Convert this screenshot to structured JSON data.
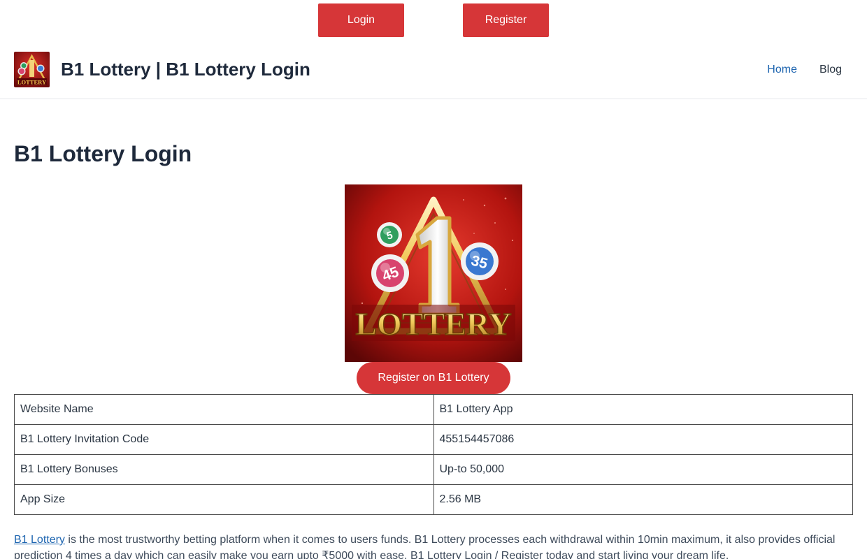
{
  "top_buttons": {
    "login": "Login",
    "register": "Register"
  },
  "header": {
    "logo_text": "LOTTERY",
    "site_title": "B1 Lottery | B1 Lottery Login",
    "nav": {
      "home": "Home",
      "blog": "Blog"
    },
    "nav_active_color": "#1e65b0"
  },
  "page": {
    "title": "B1 Lottery Login"
  },
  "hero": {
    "balls": [
      "5",
      "45",
      "35"
    ],
    "big_number": "1",
    "word": "LOTTERY"
  },
  "cta": {
    "label": "Register on B1 Lottery"
  },
  "colors": {
    "button_red": "#d63638",
    "link_blue": "#1e65b0"
  },
  "table": {
    "rows": [
      {
        "label": "Website Name",
        "value": "B1 Lottery App"
      },
      {
        "label": "B1 Lottery Invitation Code",
        "value": "455154457086"
      },
      {
        "label": "B1 Lottery Bonuses",
        "value": "Up-to 50,000"
      },
      {
        "label": "App Size",
        "value": "2.56 MB"
      }
    ]
  },
  "intro": {
    "link": "B1 Lottery",
    "text": " is the most trustworthy betting platform when it comes to users funds. B1 Lottery processes each withdrawal within 10min maximum, it also provides official prediction 4 times a day which can easily make you earn upto ₹5000 with ease. B1 Lottery Login / Register today and start living your dream life."
  }
}
